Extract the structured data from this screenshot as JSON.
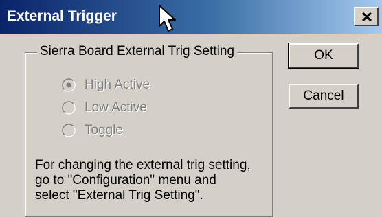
{
  "window": {
    "title": "External Trigger",
    "close_icon": "close-icon"
  },
  "group": {
    "legend": "Sierra Board External Trig Setting",
    "options": [
      {
        "label": "High Active",
        "selected": true,
        "enabled": false
      },
      {
        "label": "Low Active",
        "selected": false,
        "enabled": false
      },
      {
        "label": "Toggle",
        "selected": false,
        "enabled": false
      }
    ],
    "info_lines": [
      "For changing the external trig setting,",
      "go to \"Configuration\" menu and",
      "select \"External Trig Setting\"."
    ]
  },
  "buttons": {
    "ok_label": "OK",
    "cancel_label": "Cancel"
  },
  "colors": {
    "titlebar_start": "#0a246a",
    "titlebar_end": "#a6caf0",
    "face": "#d4d0c8",
    "disabled_text": "#808080"
  }
}
